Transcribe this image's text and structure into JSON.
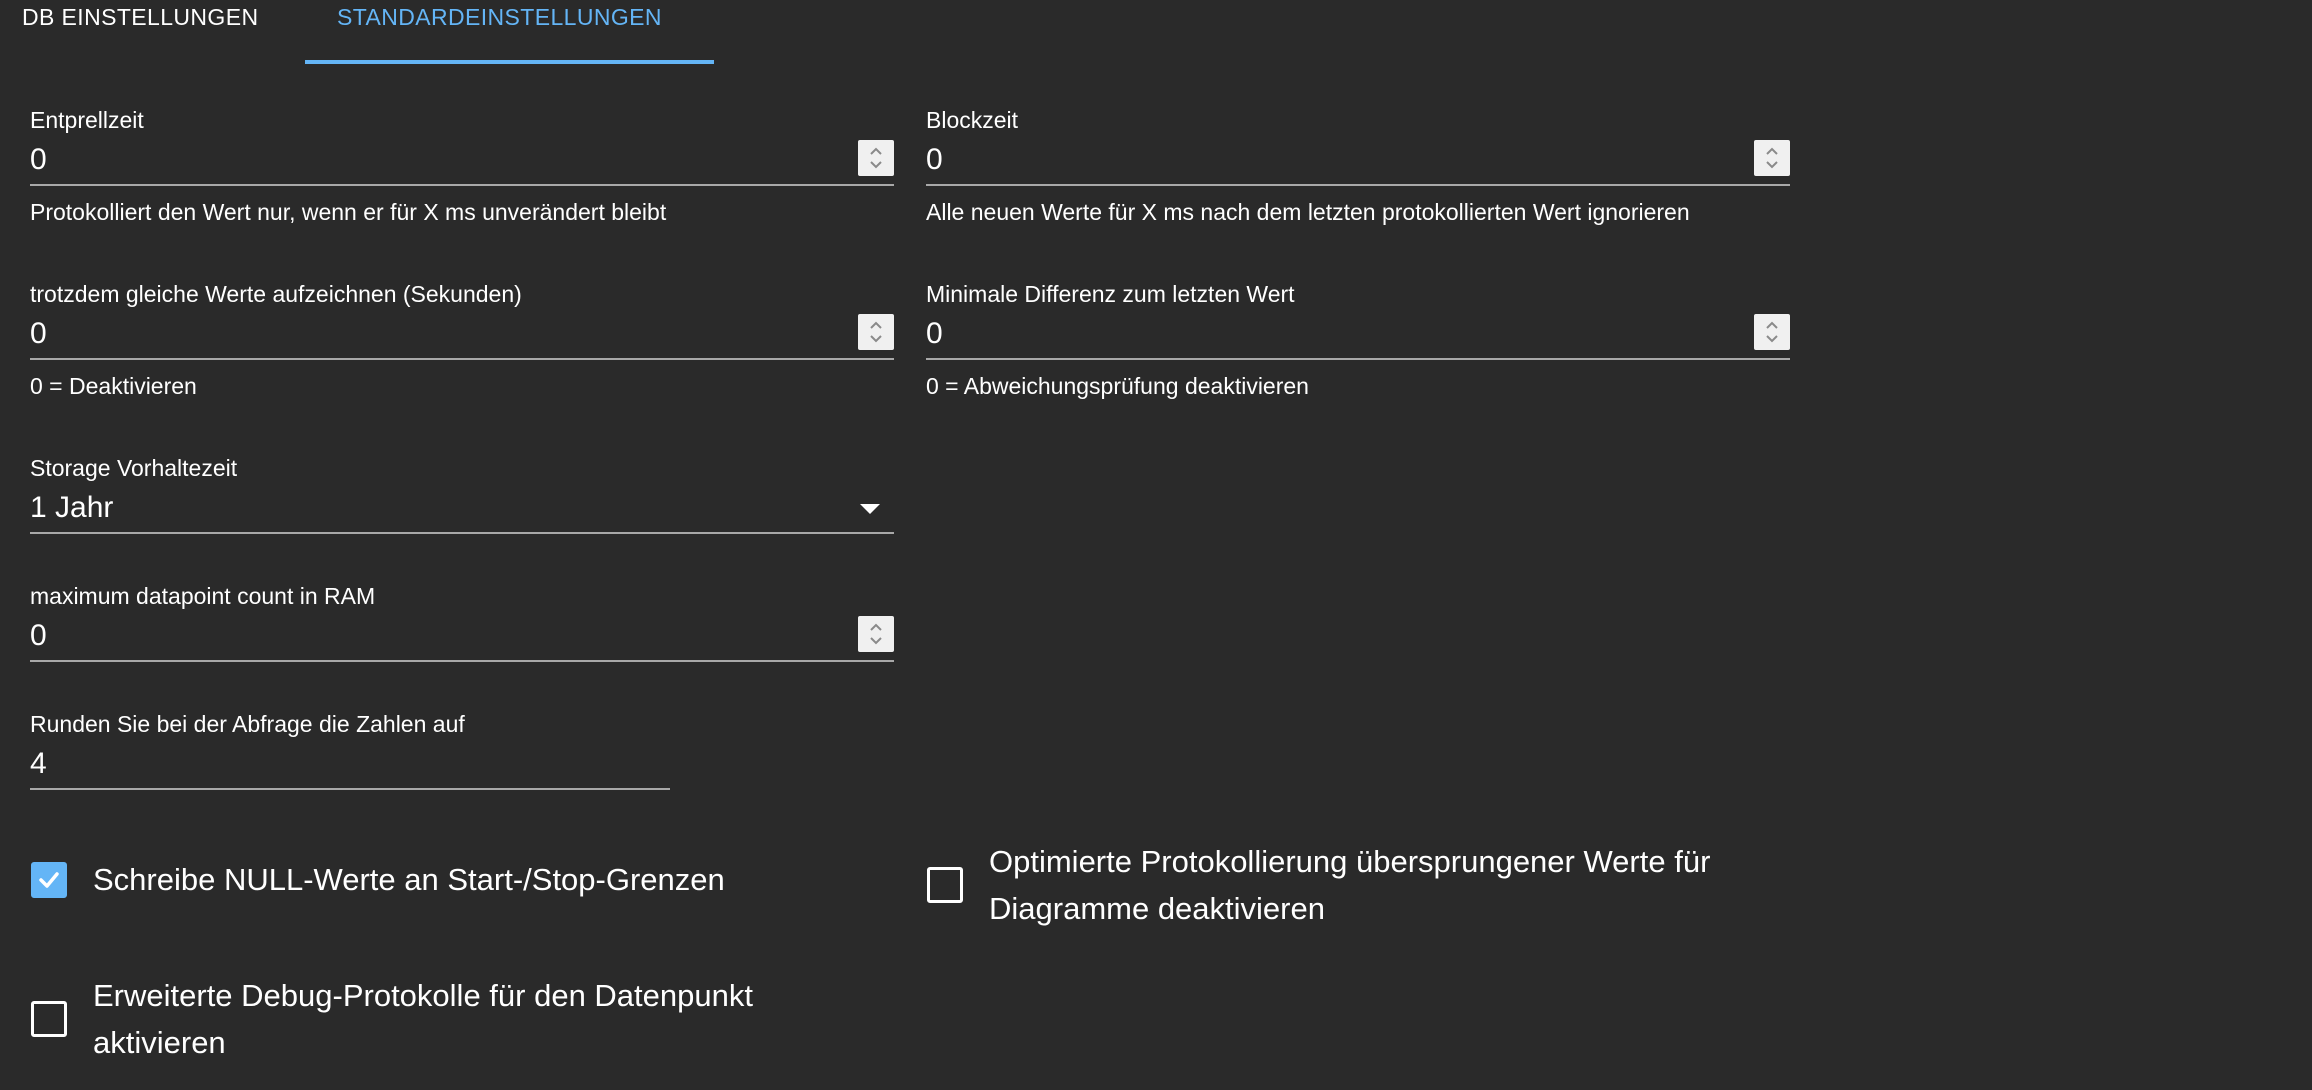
{
  "tabs": [
    {
      "label": "DB EINSTELLUNGEN",
      "active": false
    },
    {
      "label": "STANDARDEINSTELLUNGEN",
      "active": true
    }
  ],
  "fields": {
    "entprellzeit": {
      "label": "Entprellzeit",
      "value": "0",
      "helper": "Protokolliert den Wert nur, wenn er für X ms unverändert bleibt"
    },
    "blockzeit": {
      "label": "Blockzeit",
      "value": "0",
      "helper": "Alle neuen Werte für X ms nach dem letzten protokollierten Wert ignorieren"
    },
    "gleiche_werte": {
      "label": "trotzdem gleiche Werte aufzeichnen (Sekunden)",
      "value": "0",
      "helper": "0 = Deaktivieren"
    },
    "min_differenz": {
      "label": "Minimale Differenz zum letzten Wert",
      "value": "0",
      "helper": "0 = Abweichungsprüfung deaktivieren"
    },
    "storage": {
      "label": "Storage Vorhaltezeit",
      "value": "1 Jahr"
    },
    "max_ram": {
      "label": "maximum datapoint count in RAM",
      "value": "0"
    },
    "runden": {
      "label": "Runden Sie bei der Abfrage die Zahlen auf",
      "value": "4"
    }
  },
  "checkboxes": {
    "null_werte": {
      "label": "Schreibe NULL-Werte an Start-/Stop-Grenzen",
      "checked": true
    },
    "optimierte": {
      "label_line1": "Optimierte Protokollierung übersprungener Werte für",
      "label_line2": "Diagramme deaktivieren",
      "checked": false
    },
    "debug": {
      "label_line1": "Erweiterte Debug-Protokolle für den Datenpunkt",
      "label_line2": "aktivieren",
      "checked": false
    }
  },
  "colors": {
    "background": "#2a2a2a",
    "accent": "#64b5f6",
    "text": "#ffffff",
    "underline": "#a8a8a8"
  }
}
